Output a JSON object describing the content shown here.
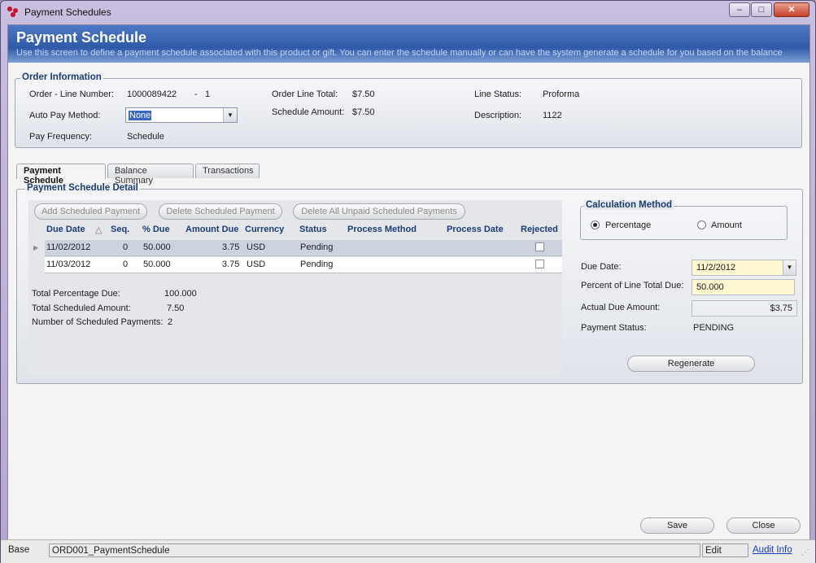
{
  "window": {
    "title": "Payment Schedules",
    "min": "–",
    "max": "□",
    "close": "✕"
  },
  "header": {
    "title": "Payment Schedule",
    "subtitle": "Use this screen to define a payment schedule associated with this product or gift. You can enter the schedule manually or can have the system generate a schedule for you based on the balance"
  },
  "order_info": {
    "legend": "Order Information",
    "line_number_label": "Order - Line Number:",
    "line_number": "1000089422",
    "line_sep": "-",
    "line_index": "1",
    "auto_pay_label": "Auto Pay Method:",
    "auto_pay_value": "None",
    "pay_frequency_label": "Pay Frequency:",
    "pay_frequency_value": "Schedule",
    "line_total_label": "Order Line Total:",
    "line_total_value": "$7.50",
    "schedule_amount_label": "Schedule Amount:",
    "schedule_amount_value": "$7.50",
    "line_status_label": "Line Status:",
    "line_status_value": "Proforma",
    "description_label": "Description:",
    "description_value": "1122"
  },
  "tabs": [
    "Payment Schedule",
    "Balance Summary",
    "Transactions"
  ],
  "detail": {
    "legend": "Payment Schedule Detail",
    "buttons": {
      "add": "Add Scheduled Payment",
      "delete": "Delete Scheduled Payment",
      "delete_all": "Delete All Unpaid Scheduled Payments"
    },
    "columns": [
      "Due Date",
      "Seq.",
      "% Due",
      "Amount Due",
      "Currency",
      "Status",
      "Process Method",
      "Process Date",
      "Rejected"
    ],
    "sort_indicator": "△",
    "rows": [
      {
        "due_date": "11/02/2012",
        "seq": "0",
        "pct": "50.000",
        "amount": "3.75",
        "currency": "USD",
        "status": "Pending",
        "method": "",
        "process_date": "",
        "rejected": false
      },
      {
        "due_date": "11/03/2012",
        "seq": "0",
        "pct": "50.000",
        "amount": "3.75",
        "currency": "USD",
        "status": "Pending",
        "method": "",
        "process_date": "",
        "rejected": false
      }
    ],
    "totals": {
      "pct_label": "Total Percentage Due:",
      "pct_value": "100.000",
      "amount_label": "Total Scheduled Amount:",
      "amount_value": "7.50",
      "count_label": "Number of Scheduled Payments:",
      "count_value": "2"
    }
  },
  "calc": {
    "legend": "Calculation Method",
    "option_percentage": "Percentage",
    "option_amount": "Amount",
    "selected": "Percentage",
    "due_date_label": "Due Date:",
    "due_date_value": "11/2/2012",
    "percent_label": "Percent of Line Total Due:",
    "percent_value": "50.000",
    "actual_label": "Actual Due Amount:",
    "actual_value": "$3.75",
    "status_label": "Payment Status:",
    "status_value": "PENDING",
    "regenerate": "Regenerate"
  },
  "footer": {
    "save": "Save",
    "close": "Close"
  },
  "statusbar": {
    "base": "Base",
    "form": "ORD001_PaymentSchedule",
    "mode": "Edit",
    "audit": "Audit Info"
  }
}
